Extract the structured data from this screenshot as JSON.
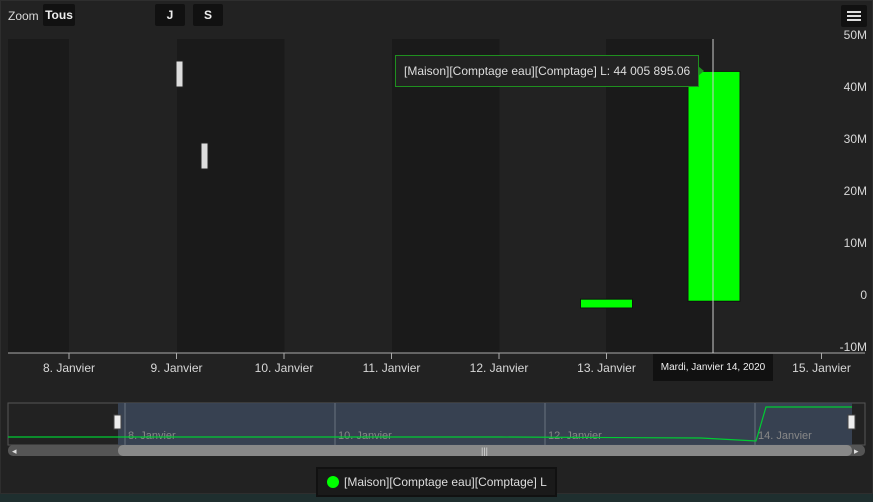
{
  "toolbar": {
    "zoom_label": "Zoom",
    "zoom_all": "Tous",
    "btn_day": "J",
    "btn_week": "S"
  },
  "menu_icon": "hamburger-menu-icon",
  "tooltip": {
    "text": "[Maison][Comptage eau][Comptage] L: 44 005 895.06"
  },
  "crosshair_label": "Mardi, Janvier 14, 2020",
  "legend": {
    "label": "[Maison][Comptage eau][Comptage] L"
  },
  "colors": {
    "series": "#00ff00",
    "background": "#222222",
    "band": "#1a1a1a",
    "navigator_mask": "#3a4556"
  },
  "chart_data": {
    "type": "candlestick",
    "series": [
      {
        "name": "[Maison][Comptage eau][Comptage] L",
        "color": "#00ff00",
        "points": [
          {
            "x": "2020-01-13",
            "low": -2500000,
            "high": -800000
          },
          {
            "x": "2020-01-14",
            "low": -1200000,
            "high": 43000000
          }
        ]
      }
    ],
    "x_ticks": [
      "8. Janvier",
      "9. Janvier",
      "10. Janvier",
      "11. Janvier",
      "12. Janvier",
      "13. Janvier",
      "15. Janvier"
    ],
    "y_ticks": [
      "50M",
      "40M",
      "30M",
      "20M",
      "10M",
      "0",
      "-10M"
    ],
    "ylim": [
      -10000000,
      50000000
    ],
    "navigator_ticks": [
      "8. Janvier",
      "10. Janvier",
      "12. Janvier",
      "14. Janvier"
    ]
  }
}
